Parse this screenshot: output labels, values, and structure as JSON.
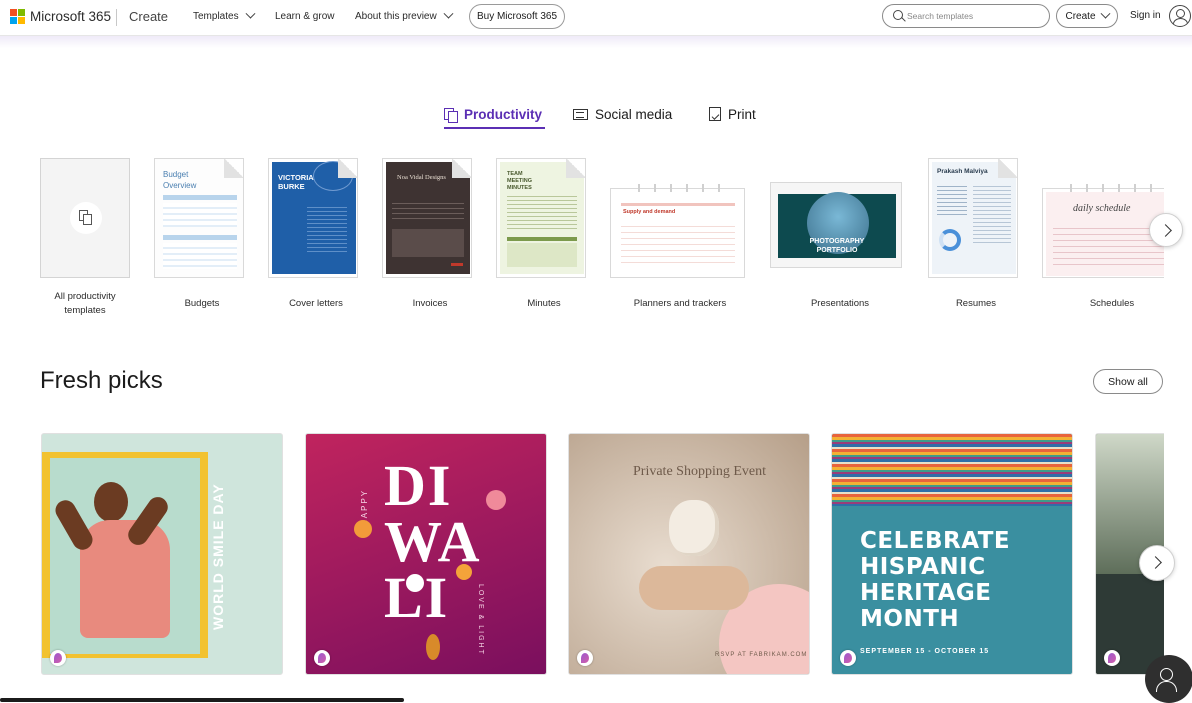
{
  "header": {
    "brand": "Microsoft 365",
    "create_link": "Create",
    "nav": [
      "Templates",
      "Learn & grow",
      "About this preview"
    ],
    "buy_label": "Buy Microsoft 365",
    "search_placeholder": "Search templates",
    "create_button": "Create",
    "signin": "Sign in",
    "logo_colors": [
      "#f25022",
      "#7fba00",
      "#00a4ef",
      "#ffb900"
    ]
  },
  "tabs": [
    {
      "label": "Productivity",
      "active": true,
      "icon": "documents-icon"
    },
    {
      "label": "Social media",
      "active": false,
      "icon": "screen-icon"
    },
    {
      "label": "Print",
      "active": false,
      "icon": "printer-icon"
    }
  ],
  "accent_color": "#5b2fb4",
  "categories": {
    "all": "All productivity templates",
    "items": [
      "Budgets",
      "Cover letters",
      "Invoices",
      "Minutes",
      "Planners and trackers",
      "Presentations",
      "Resumes",
      "Schedules"
    ],
    "thumb_text": {
      "budget_title": "Budget Overview",
      "cover_name": "VICTORIA BURKE",
      "invoice_company": "Noa Vidal Designs",
      "minutes_title": "TEAM MEETING MINUTES",
      "planner_title": "Supply and demand",
      "presentation_title": "PHOTOGRAPHY PORTFOLIO",
      "resume_name": "Prakash Malviya",
      "schedule_title": "daily schedule"
    }
  },
  "fresh": {
    "title": "Fresh picks",
    "show_all": "Show all",
    "cards": {
      "smile": "WORLD SMILE DAY",
      "diwali_happy": "HAPPY",
      "diwali_lines": [
        "DI",
        "WA",
        "LI"
      ],
      "diwali_side": "LOVE & LIGHT",
      "shopping_title": "Private Shopping Event",
      "shopping_rsvp": "RSVP AT FABRIKAM.COM",
      "hispanic_lines": [
        "CELEBRATE",
        "HISPANIC",
        "HERITAGE",
        "MONTH"
      ],
      "hispanic_dates": "SEPTEMBER 15 - OCTOBER 15"
    }
  }
}
